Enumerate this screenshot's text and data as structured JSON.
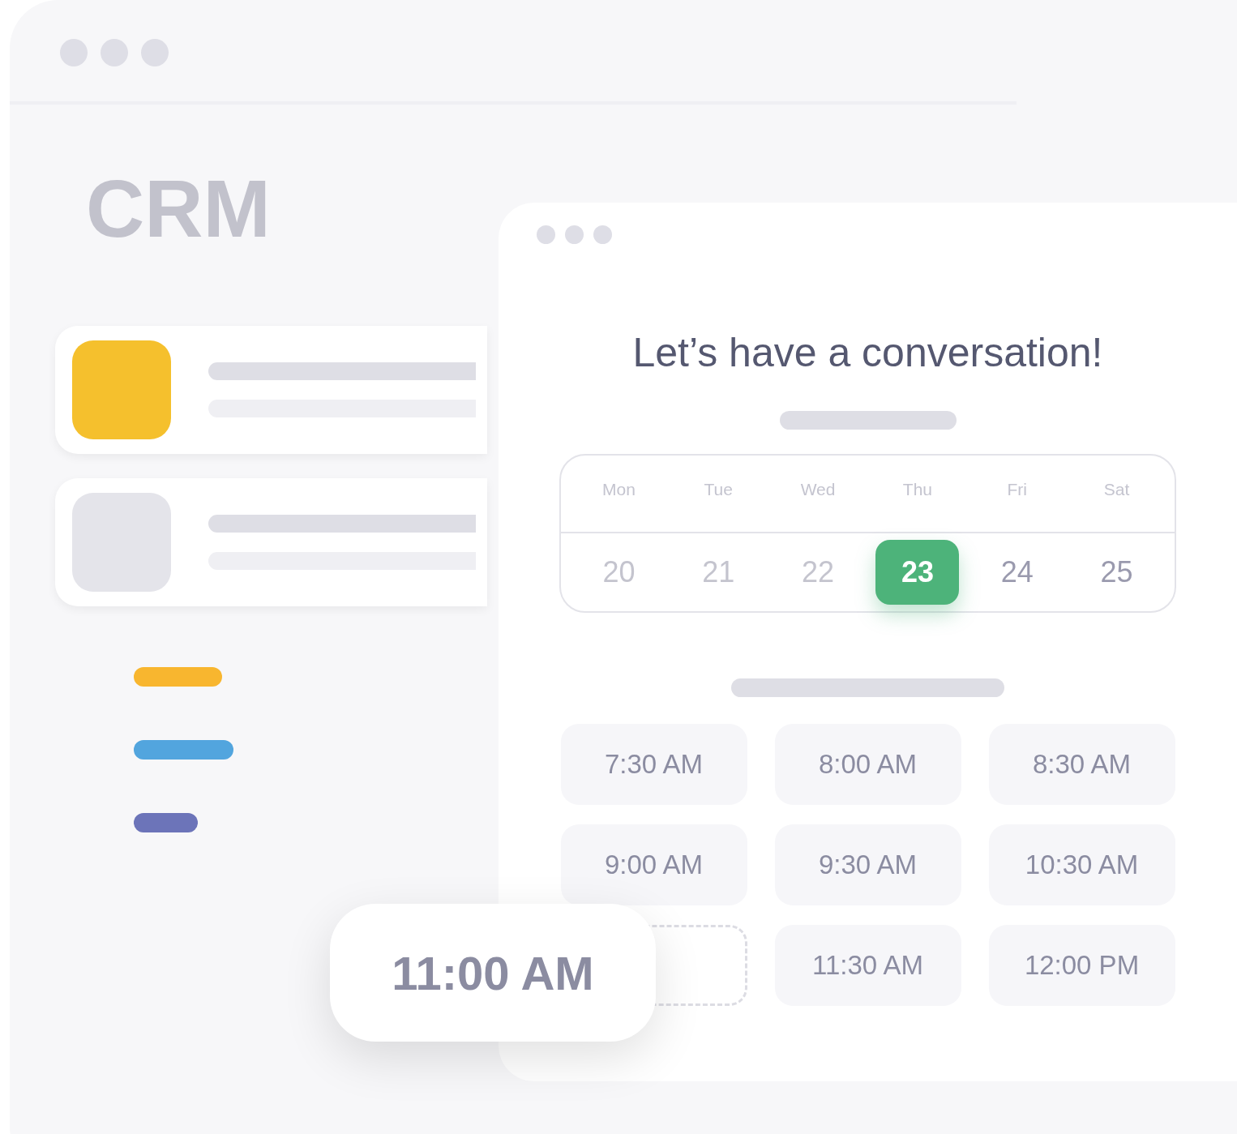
{
  "back_window": {
    "title": "CRM",
    "tags": [
      {
        "color": "#f8b62f"
      },
      {
        "color": "#52a5de"
      },
      {
        "color": "#6c74b9"
      }
    ]
  },
  "booking": {
    "heading": "Let’s have a conversation!",
    "days": [
      {
        "name": "Mon",
        "date": "20",
        "disabled": true,
        "selected": false
      },
      {
        "name": "Tue",
        "date": "21",
        "disabled": true,
        "selected": false
      },
      {
        "name": "Wed",
        "date": "22",
        "disabled": true,
        "selected": false
      },
      {
        "name": "Thu",
        "date": "23",
        "disabled": false,
        "selected": true
      },
      {
        "name": "Fri",
        "date": "24",
        "disabled": false,
        "selected": false
      },
      {
        "name": "Sat",
        "date": "25",
        "disabled": false,
        "selected": false
      }
    ],
    "slots": [
      {
        "kind": "slot",
        "label": "7:30 AM"
      },
      {
        "kind": "slot",
        "label": "8:00 AM"
      },
      {
        "kind": "slot",
        "label": "8:30 AM"
      },
      {
        "kind": "slot",
        "label": "9:00 AM"
      },
      {
        "kind": "slot",
        "label": "9:30 AM"
      },
      {
        "kind": "slot",
        "label": "10:30 AM"
      },
      {
        "kind": "drop-target"
      },
      {
        "kind": "slot",
        "label": "11:30 AM"
      },
      {
        "kind": "slot",
        "label": "12:00 PM"
      }
    ],
    "dragged_slot": {
      "label": "11:00 AM"
    }
  }
}
